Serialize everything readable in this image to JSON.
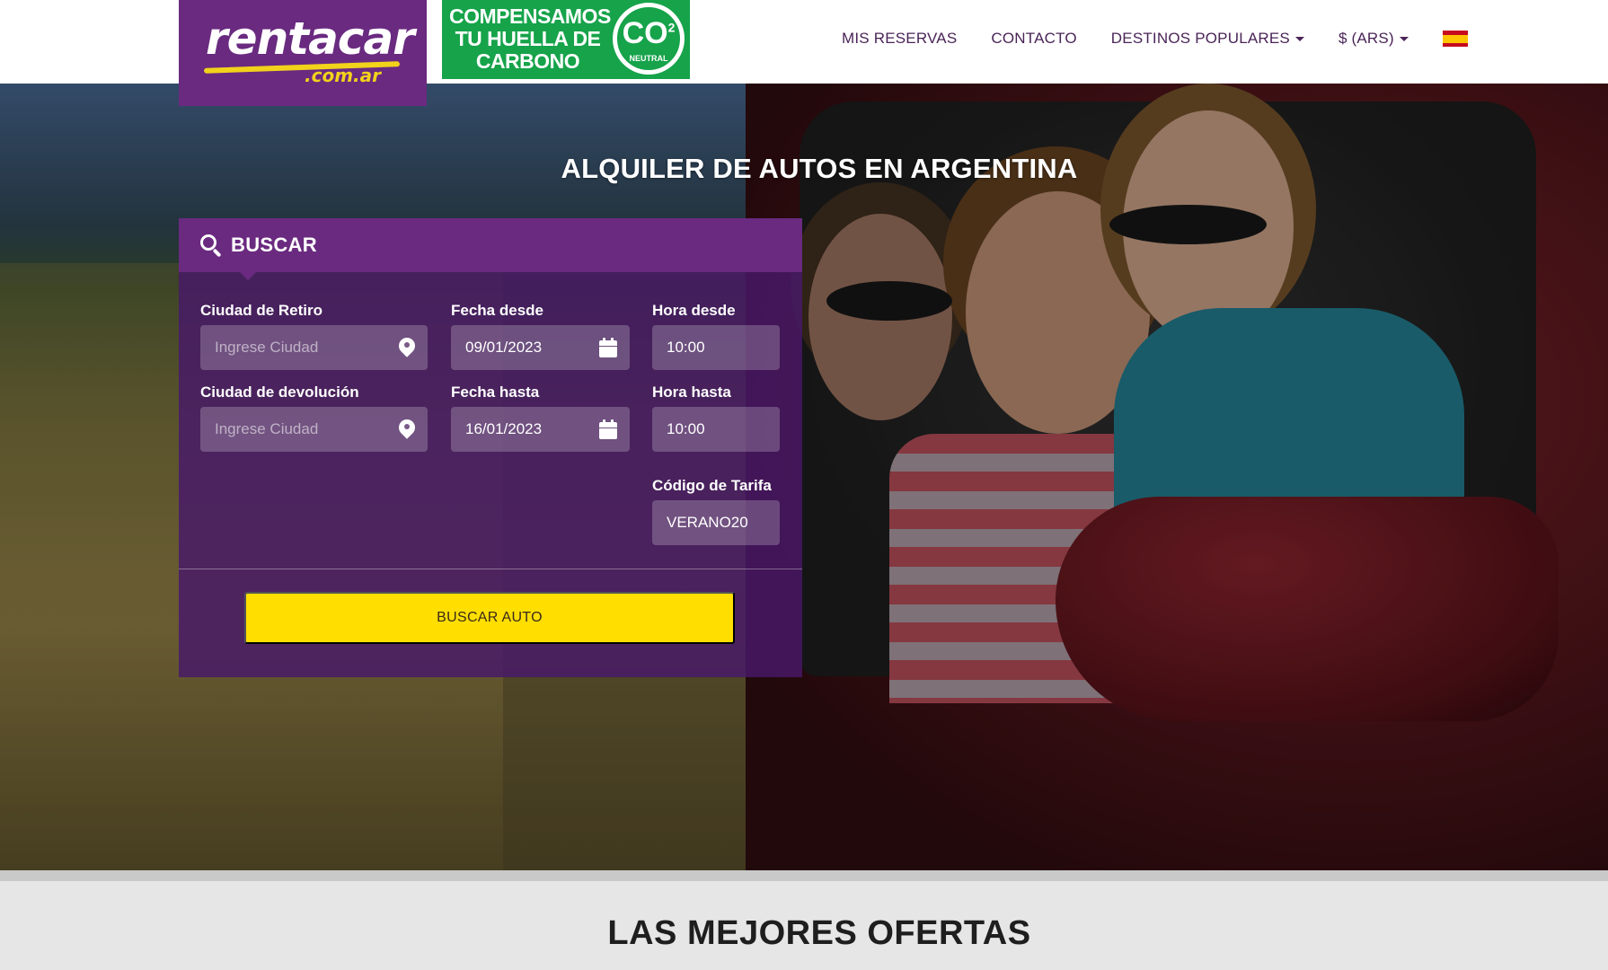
{
  "brand": {
    "logo_main": "rentacar",
    "logo_sub": ".com.ar",
    "carbon_badge": "COMPENSAMOS TU HUELLA DE CARBONO",
    "carbon_co2": "CO",
    "carbon_neutral": "NEUTRAL"
  },
  "nav": {
    "items": [
      {
        "label": "MIS RESERVAS",
        "dropdown": false
      },
      {
        "label": "CONTACTO",
        "dropdown": false
      },
      {
        "label": "DESTINOS POPULARES",
        "dropdown": true
      },
      {
        "label": "$ (ARS)",
        "dropdown": true
      }
    ],
    "language_flag": "spain-flag-icon"
  },
  "hero": {
    "title": "ALQUILER DE AUTOS EN ARGENTINA"
  },
  "search": {
    "header": "BUSCAR",
    "pickup_city_label": "Ciudad de Retiro",
    "pickup_city_placeholder": "Ingrese Ciudad",
    "date_from_label": "Fecha desde",
    "date_from_value": "09/01/2023",
    "time_from_label": "Hora desde",
    "time_from_value": "10:00",
    "return_city_label": "Ciudad de devolución",
    "return_city_placeholder": "Ingrese Ciudad",
    "date_to_label": "Fecha hasta",
    "date_to_value": "16/01/2023",
    "time_to_label": "Hora hasta",
    "time_to_value": "10:00",
    "rate_code_label": "Código de Tarifa",
    "rate_code_value": "VERANO20",
    "submit_label": "BUSCAR AUTO"
  },
  "offers": {
    "title": "LAS MEJORES OFERTAS"
  },
  "colors": {
    "brand_purple": "#6a2a80",
    "accent_yellow": "#ffde00",
    "carbon_green": "#16a34a",
    "nav_text": "#4a2457"
  }
}
